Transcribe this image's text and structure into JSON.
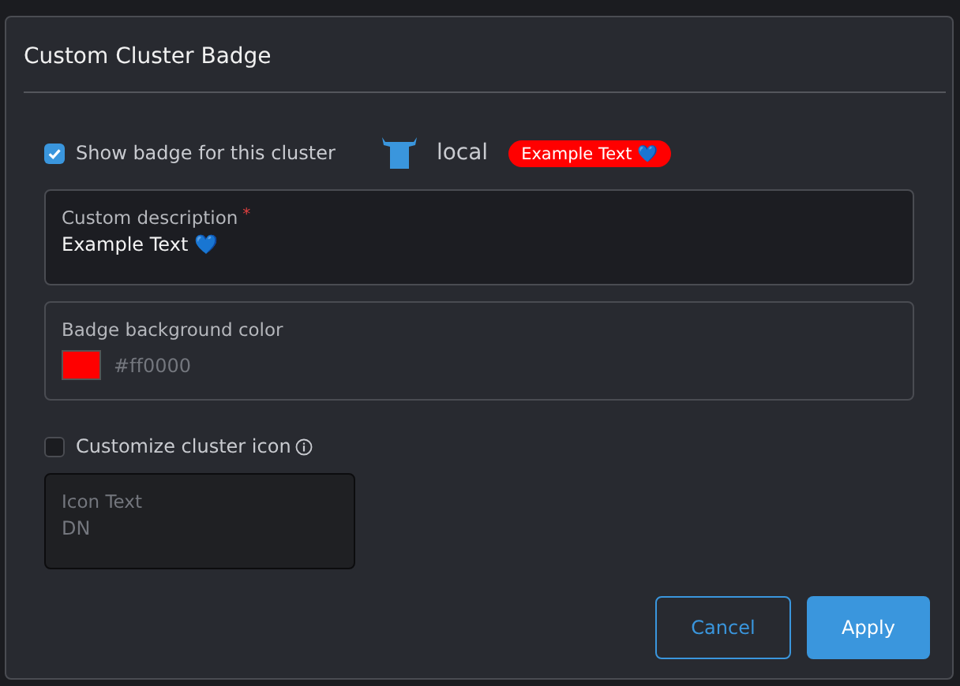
{
  "dialog": {
    "title": "Custom Cluster Badge",
    "show_badge": {
      "label": "Show badge for this cluster",
      "checked": true
    },
    "preview": {
      "cluster_name": "local",
      "badge_text": "Example Text 💙"
    },
    "description": {
      "label": "Custom description",
      "required_mark": "*",
      "value": "Example Text 💙"
    },
    "badge_color_field": {
      "label": "Badge background color",
      "value": "#ff0000"
    },
    "customize_icon": {
      "label": "Customize cluster icon",
      "checked": false
    },
    "icon_text": {
      "label": "Icon Text",
      "value": "DN",
      "disabled": true
    },
    "buttons": [
      {
        "label": "Cancel",
        "kind": "secondary"
      },
      {
        "label": "Apply",
        "kind": "primary"
      }
    ]
  }
}
